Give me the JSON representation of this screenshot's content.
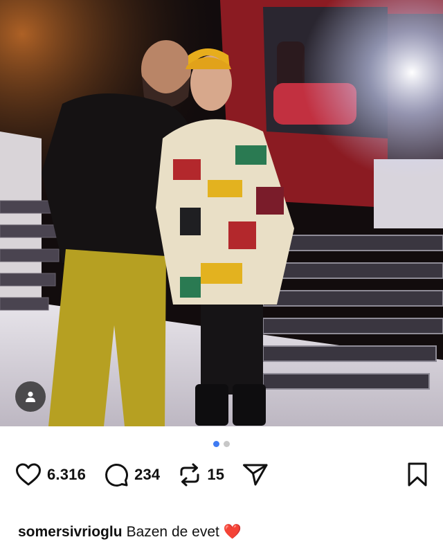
{
  "post": {
    "likes": "6.316",
    "comments": "234",
    "reposts": "15",
    "carousel": {
      "total": 2,
      "active": 0
    },
    "caption": {
      "username": "somersivrioglu",
      "text": "Bazen de evet",
      "emoji": "❤️"
    }
  },
  "colors": {
    "accent": "#3f7bf2",
    "dot_inactive": "#c7c7c7",
    "heart": "#e02a36"
  },
  "icons": {
    "like": "heart-outline-icon",
    "comment": "comment-bubble-icon",
    "repost": "repost-arrows-icon",
    "share": "paper-plane-icon",
    "save": "bookmark-icon",
    "tag": "person-icon"
  }
}
